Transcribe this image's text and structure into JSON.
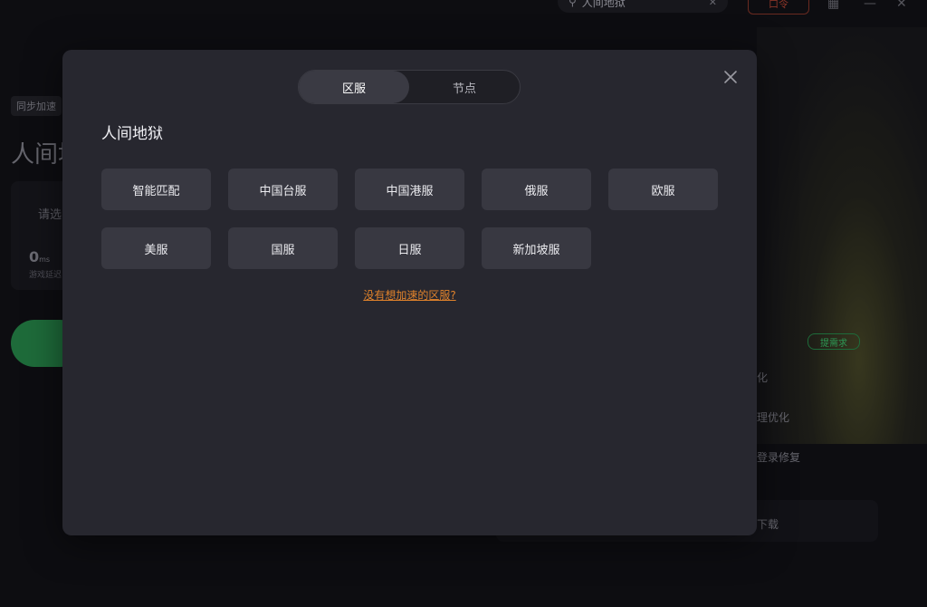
{
  "background": {
    "search": {
      "value": "人间地狱",
      "icon": "search-icon",
      "clear_icon": "close-icon"
    },
    "top_badge": "口令",
    "tag": "同步加速",
    "title": "人间地",
    "select_hint": "请选",
    "latency": "0",
    "latency_unit": "ms",
    "latency_sub": "游戏延迟",
    "request_badge": "提需求",
    "list": [
      "化",
      "理优化",
      "登录修复"
    ],
    "footer": "下载"
  },
  "modal": {
    "tabs": [
      {
        "label": "区服",
        "active": true
      },
      {
        "label": "节点",
        "active": false
      }
    ],
    "close_icon": "close-icon",
    "game_title": "人间地狱",
    "servers": [
      "智能匹配",
      "中国台服",
      "中国港服",
      "俄服",
      "欧服",
      "美服",
      "国服",
      "日服",
      "新加坡服"
    ],
    "missing_link": "没有想加速的区服?"
  },
  "colors": {
    "modal_bg": "#27272f",
    "button_bg": "#383841",
    "active_tab": "#3a3a43",
    "link": "#e0822b",
    "accent_green": "#1e6b3a"
  }
}
